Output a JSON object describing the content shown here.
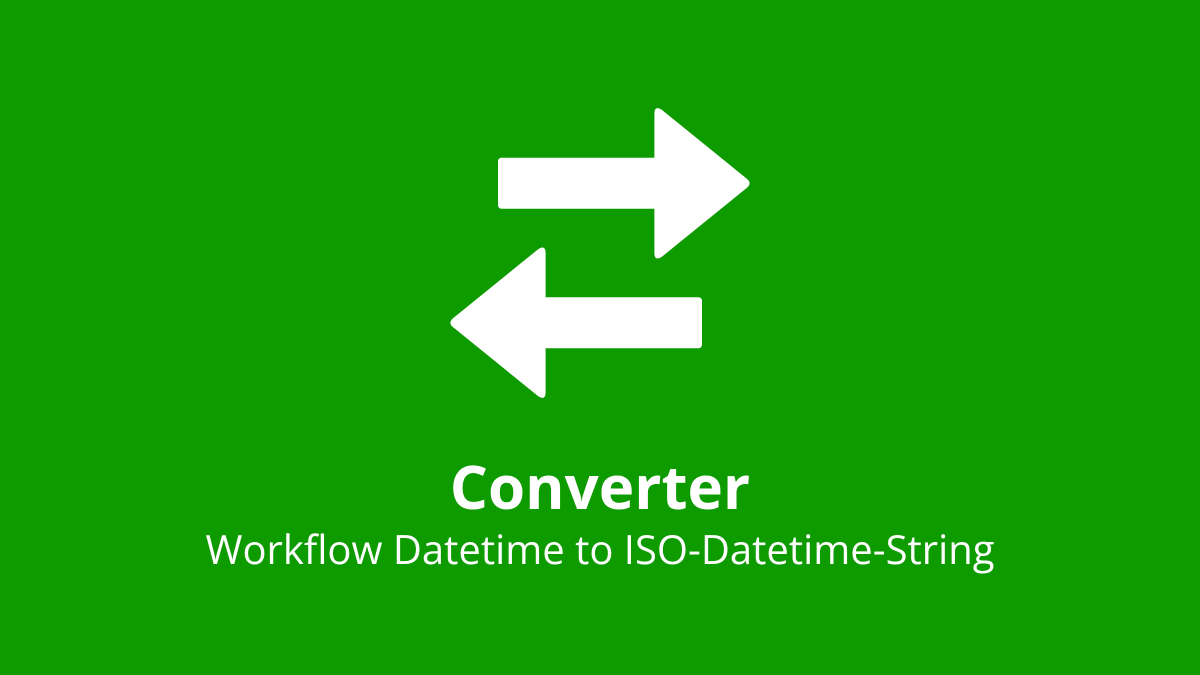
{
  "card": {
    "title": "Converter",
    "subtitle": "Workflow Datetime to ISO-Datetime-String",
    "icon": "exchange-arrows-icon",
    "accent_color": "#0E9B00",
    "text_color": "#ffffff"
  }
}
